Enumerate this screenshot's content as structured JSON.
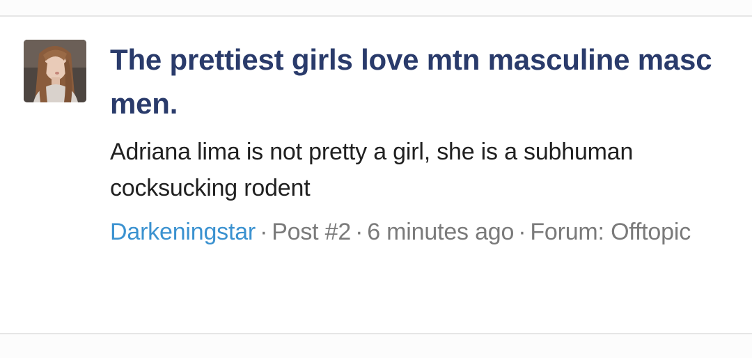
{
  "result": {
    "avatar_icon": "user-photo-avatar",
    "title": "The prettiest girls love mtn masculine masc men.",
    "snippet": "Adriana lima is not pretty a girl, she is a subhuman cocksucking rodent",
    "author": "Darkeningstar",
    "separator": "·",
    "post": "Post #2",
    "time": "6 minutes ago",
    "forum_label": "Forum:",
    "forum": "Offtopic"
  },
  "colors": {
    "title": "#2a3b6b",
    "author_link": "#3b92d0",
    "meta_text": "#7a7a7a",
    "snippet_text": "#202020"
  }
}
